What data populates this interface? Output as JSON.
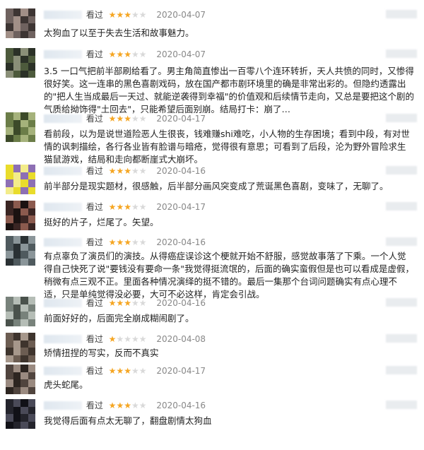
{
  "reviews": [
    {
      "viewed": "看过",
      "stars": 3,
      "date": "2020-04-07",
      "text": "太狗血了以至于失去生活和故事魅力。",
      "avatar": [
        "#6f625f",
        "#3d3533",
        "#a18f87"
      ]
    },
    {
      "viewed": "看过",
      "stars": 3,
      "date": "2020-04-07",
      "text": "3.5 一口气把前半部刷给看了。男主角简直惨出一百零八个连环转折，天人共愤的同时，又惨得很好笑。这一连串的黑色喜剧戏码，放在国产都市剧环境里的确是非常出彩的。但隐约透露出的\"把人生当成最后一天过、就能逆袭得到幸福\"的价值观和后续情节走向，又总是要把这个剧的气质给拗饰得\"土回去\"，只能希望后面别崩。结局打卡：崩了…",
      "avatar": [
        "#4d5a3c",
        "#2b3127",
        "#8a8f78"
      ]
    },
    {
      "viewed": "看过",
      "stars": 3,
      "date": "2020-04-17",
      "text": "看前段，以为是说世道险恶人生很丧，钱难赚shi难吃，小人物的生存困境；看到中段，有对世情的讽刺描绘，各行各业皆有脸谱与暗疮，觉得很有意思；可看到了后段，沦为野外冒险求生猫鼠游戏，结局和走向都断崖式大崩坏。",
      "avatar": [
        "#6b7d48",
        "#a5b27b",
        "#3c4a29"
      ]
    },
    {
      "viewed": "看过",
      "stars": 3,
      "date": "2020-04-16",
      "text": "前半部分是现实题材，很感触，后半部分画风突变成了荒诞黑色喜剧，变味了，无聊了。",
      "avatar": [
        "#e9dc2b",
        "#8d6fb4",
        "#f3ec8a"
      ]
    },
    {
      "viewed": "看过",
      "stars": 3,
      "date": "2020-04-17",
      "text": "挺好的片子，烂尾了。矢望。",
      "avatar": [
        "#3a2523",
        "#8b5a4e",
        "#1b1211"
      ]
    },
    {
      "viewed": "看过",
      "stars": 3,
      "date": "2020-04-16",
      "text": "有点辜负了演员们的演技。从得癌症误诊这个梗就开始不舒服，感觉故事落了下乘。一个人觉得自己快死了说\"要钱没有要命一条\"我觉得挺流氓的，后面的确实蛮假但是也可以看成是虚假，稍微有点三观不正。里面各种情况演绎的挺不错的。最后一集那个台词问题确实有点心理不适，只是单纯觉得没必要，大可不必这样，肯定会引战。",
      "avatar": [
        "#4f5a5e",
        "#8a9599",
        "#2a3134"
      ]
    },
    {
      "viewed": "看过",
      "stars": 3,
      "date": "2020-04-16",
      "text": "前面好好的，后面完全崩成糊闹剧了。",
      "avatar": [
        "#78827b",
        "#b5bdb6",
        "#4a524c"
      ]
    },
    {
      "viewed": "看过",
      "stars": 1,
      "date": "2020-04-08",
      "text": "矫情扭捏的写实，反而不真实",
      "avatar": [
        "#6c5d52",
        "#3e342d",
        "#a6978b"
      ]
    },
    {
      "viewed": "看过",
      "stars": 3,
      "date": "2020-04-17",
      "text": "虎头蛇尾。",
      "avatar": [
        "#50443e",
        "#9a8a80",
        "#2d2521"
      ]
    },
    {
      "viewed": "看过",
      "stars": 3,
      "date": "2020-04-16",
      "text": "我觉得后面有点太无聊了，翻盘剧情太狗血",
      "avatar": [
        "#24242c",
        "#4a4a58",
        "#111117"
      ]
    }
  ],
  "colors": {
    "star_on": "#f5a623",
    "star_off": "#d9d9d9"
  }
}
